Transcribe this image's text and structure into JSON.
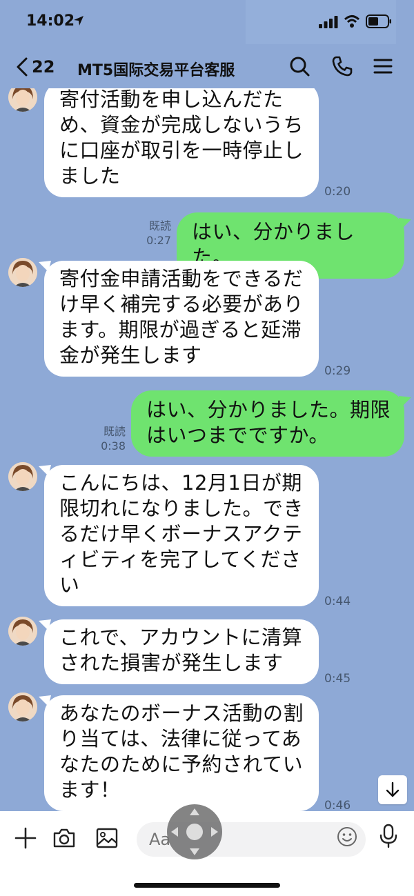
{
  "status_bar": {
    "time": "14:02"
  },
  "header": {
    "back_count": "22",
    "title": "MT5国际交易平台客服"
  },
  "messages": [
    {
      "side": "in",
      "lines": [
        "寄付活動を申し込んだた",
        "め、資金が完成しないうち",
        "に口座が取引を一時停止し",
        "ました"
      ],
      "time": "0:20"
    },
    {
      "side": "out",
      "lines": [
        "はい、分かりました。"
      ],
      "read": "既読",
      "time": "0:27"
    },
    {
      "side": "in",
      "lines": [
        "寄付金申請活動をできるだ",
        "け早く補完する必要があり",
        "ます。期限が過ぎると延滞",
        "金が発生します"
      ],
      "time": "0:29"
    },
    {
      "side": "out",
      "lines": [
        "はい、分かりました。期限",
        "はいつまでですか。"
      ],
      "read": "既読",
      "time": "0:38"
    },
    {
      "side": "in",
      "lines": [
        "こんにちは、12月1日が期",
        "限切れになりました。でき",
        "るだけ早くボーナスアクテ",
        "ィビティを完了してくださ",
        "い"
      ],
      "time": "0:44"
    },
    {
      "side": "in",
      "lines": [
        "これで、アカウントに清算",
        "された損害が発生します"
      ],
      "time": "0:45"
    },
    {
      "side": "in",
      "lines": [
        "あなたのボーナス活動の割",
        "り当ては、法律に従ってあ",
        "なたのために予約されてい",
        "ます！"
      ],
      "time": "0:46"
    }
  ],
  "input": {
    "placeholder": "Aa"
  },
  "colors": {
    "background": "#8ea9d6",
    "incoming_bubble": "#ffffff",
    "outgoing_bubble": "#6fe36f"
  },
  "icons": [
    "location-arrow-icon",
    "signal-icon",
    "wifi-icon",
    "battery-icon",
    "chevron-left-icon",
    "search-icon",
    "phone-icon",
    "menu-icon",
    "plus-icon",
    "camera-icon",
    "image-icon",
    "emoji-icon",
    "mic-icon",
    "arrow-down-icon"
  ]
}
